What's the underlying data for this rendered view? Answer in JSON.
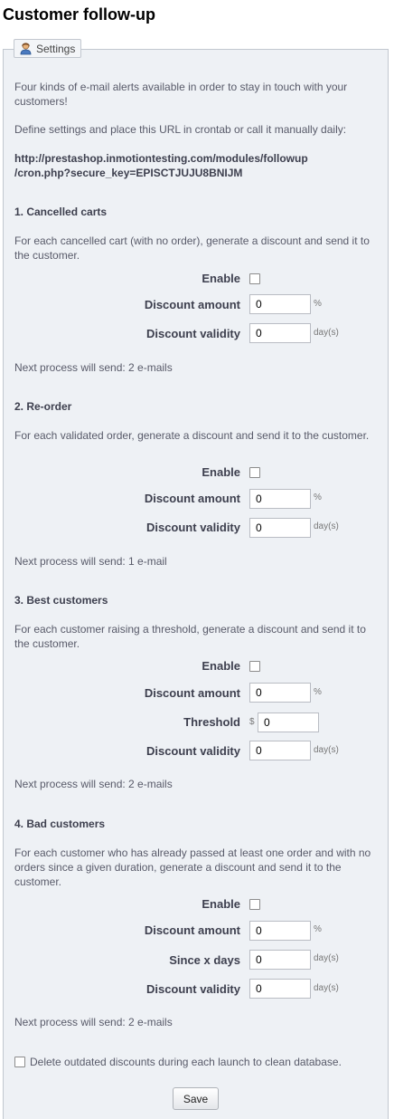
{
  "page": {
    "title": "Customer follow-up"
  },
  "settings": {
    "legend": "Settings",
    "intro": "Four kinds of e-mail alerts available in order to stay in touch with your customers!",
    "define": "Define settings and place this URL in crontab or call it manually daily:",
    "url_line1": "http://prestashop.inmotiontesting.com/modules/followup",
    "url_line2": "/cron.php?secure_key=EPISCTJUJU8BNIJM"
  },
  "sections": [
    {
      "title": "1. Cancelled carts",
      "desc": "For each cancelled cart (with no order), generate a discount and send it to the customer.",
      "enable_label": "Enable",
      "discount_label": "Discount amount",
      "discount_value": "0",
      "discount_unit": "%",
      "validity_label": "Discount validity",
      "validity_value": "0",
      "validity_unit": "day(s)",
      "next": "Next process will send: 2 e-mails"
    },
    {
      "title": "2. Re-order",
      "desc": "For each validated order, generate a discount and send it to the customer.",
      "enable_label": "Enable",
      "discount_label": "Discount amount",
      "discount_value": "0",
      "discount_unit": "%",
      "validity_label": "Discount validity",
      "validity_value": "0",
      "validity_unit": "day(s)",
      "next": "Next process will send: 1 e-mail"
    },
    {
      "title": "3. Best customers",
      "desc": "For each customer raising a threshold, generate a discount and send it to the customer.",
      "enable_label": "Enable",
      "discount_label": "Discount amount",
      "discount_value": "0",
      "discount_unit": "%",
      "threshold_label": "Threshold",
      "threshold_prefix": "$",
      "threshold_value": "0",
      "validity_label": "Discount validity",
      "validity_value": "0",
      "validity_unit": "day(s)",
      "next": "Next process will send: 2 e-mails"
    },
    {
      "title": "4. Bad customers",
      "desc": "For each customer who has already passed at least one order and with no orders since a given duration, generate a discount and send it to the customer.",
      "enable_label": "Enable",
      "discount_label": "Discount amount",
      "discount_value": "0",
      "discount_unit": "%",
      "since_label": "Since x days",
      "since_value": "0",
      "since_unit": "day(s)",
      "validity_label": "Discount validity",
      "validity_value": "0",
      "validity_unit": "day(s)",
      "next": "Next process will send: 2 e-mails"
    }
  ],
  "footer": {
    "delete_label": "Delete outdated discounts during each launch to clean database.",
    "save_label": "Save"
  },
  "icons": {
    "legend_icon": "user-icon"
  }
}
